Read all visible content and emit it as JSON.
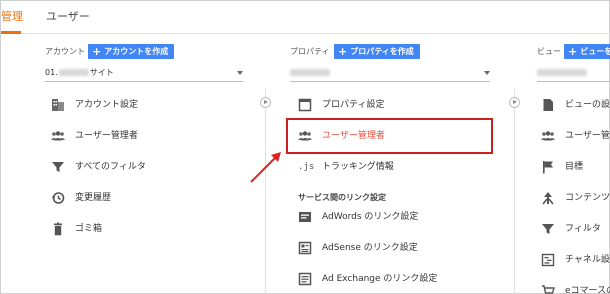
{
  "tabs": [
    {
      "label": "管理",
      "active": true
    },
    {
      "label": "ユーザー",
      "active": false
    }
  ],
  "account_col": {
    "label": "アカウント",
    "create_label": "アカウントを作成",
    "selected_value": "01.",
    "selected_suffix": "サイト",
    "items": [
      {
        "label": "アカウント設定",
        "icon": "building-icon"
      },
      {
        "label": "ユーザー管理者",
        "icon": "users-icon"
      },
      {
        "label": "すべてのフィルタ",
        "icon": "filter-icon"
      },
      {
        "label": "変更履歴",
        "icon": "history-icon"
      },
      {
        "label": "ゴミ箱",
        "icon": "trash-icon"
      }
    ]
  },
  "property_col": {
    "label": "プロパティ",
    "create_label": "プロパティを作成",
    "items": [
      {
        "label": "プロパティ設定",
        "icon": "square-icon"
      },
      {
        "label": "ユーザー管理者",
        "icon": "users-icon",
        "highlighted": true
      },
      {
        "label": "トラッキング情報",
        "icon": "js-icon"
      }
    ],
    "section_title": "サービス間のリンク設定",
    "link_items": [
      {
        "label": "AdWords のリンク設定",
        "icon": "adwords-icon"
      },
      {
        "label": "AdSense のリンク設定",
        "icon": "adsense-icon"
      },
      {
        "label": "Ad Exchange のリンク設定",
        "icon": "adexchange-icon"
      }
    ]
  },
  "view_col": {
    "label": "ビュー",
    "create_label": "ビューを作",
    "items": [
      {
        "label": "ビューの設定",
        "icon": "doc-icon"
      },
      {
        "label": "ユーザー管理",
        "icon": "users-icon"
      },
      {
        "label": "目標",
        "icon": "flag-icon"
      },
      {
        "label": "コンテンツ",
        "icon": "content-icon"
      },
      {
        "label": "フィルタ",
        "icon": "filter-icon"
      },
      {
        "label": "チャネル設定",
        "icon": "channel-icon"
      },
      {
        "label": "eコマースの",
        "icon": "cart-icon"
      }
    ]
  },
  "colors": {
    "accent_orange": "#e8710a",
    "button_blue": "#4285f4",
    "highlight_red": "#d01e1e",
    "highlight_text": "#e14b3b"
  }
}
